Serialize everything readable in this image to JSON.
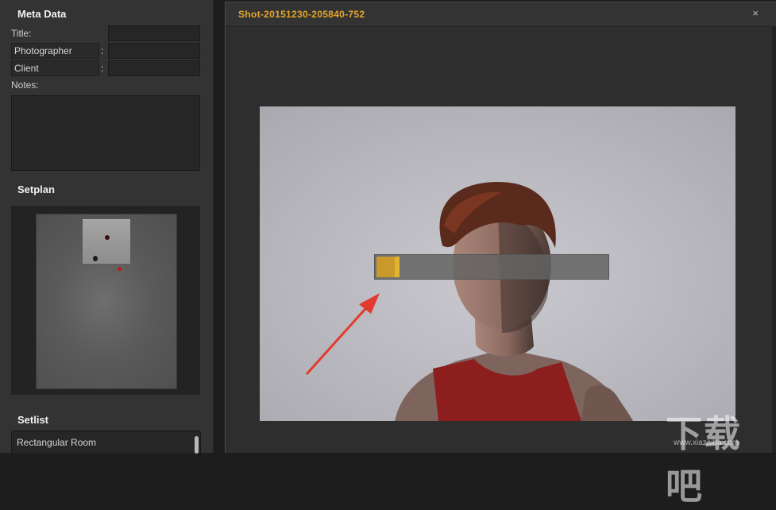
{
  "meta_data": {
    "title": "Meta Data",
    "title_label": "Title:",
    "title_value": "",
    "photographer_label": "Photographer",
    "photographer_value": "",
    "client_label": "Client",
    "client_value": "",
    "colon": ":",
    "notes_label": "Notes:",
    "notes_value": ""
  },
  "setplan": {
    "title": "Setplan"
  },
  "setlist": {
    "title": "Setlist",
    "selected": "Rectangular Room"
  },
  "dialog": {
    "title": "Shot-20151230-205840-752",
    "close_glyph": "×",
    "progress": 0.1
  },
  "watermark": {
    "text": "下载吧",
    "sub": "www.xiazaiba.com"
  },
  "colors": {
    "accent": "#e5a52a",
    "progress": "#c99a29",
    "panel": "#333333"
  }
}
